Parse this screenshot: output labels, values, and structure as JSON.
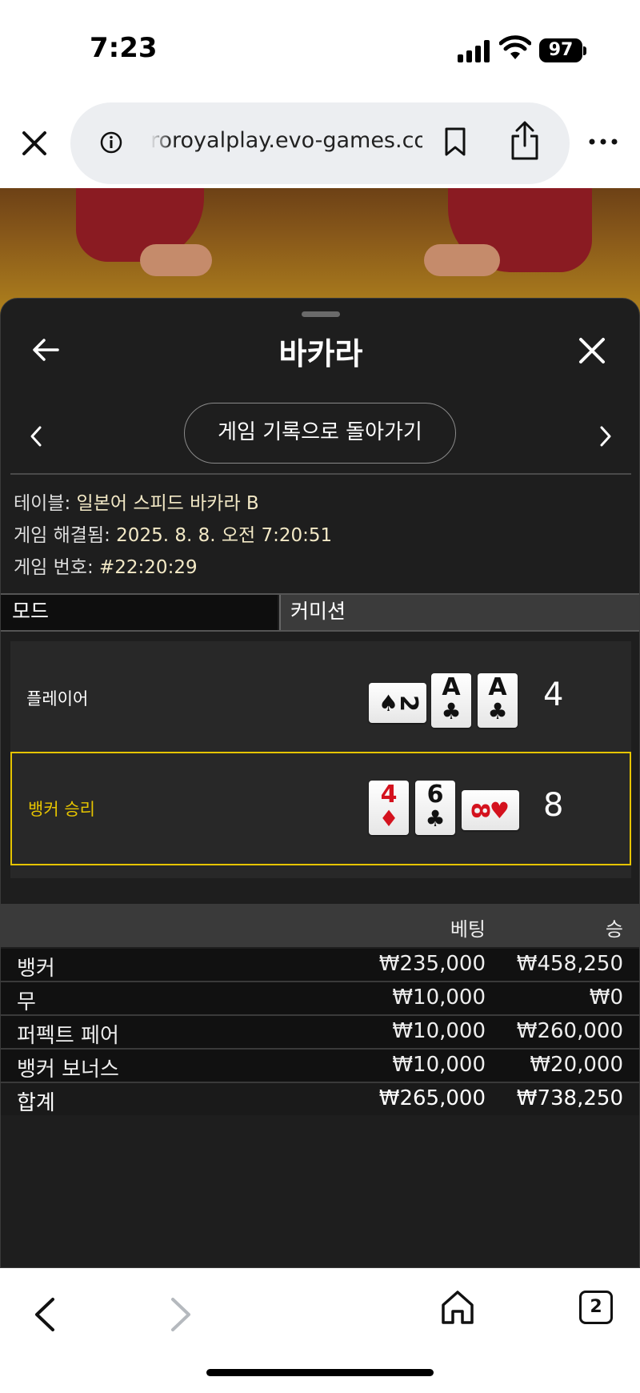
{
  "status_bar": {
    "time": "7:23",
    "battery": "97"
  },
  "browser": {
    "url": "roroyalplay.evo-games.com",
    "tab_count": "2"
  },
  "panel": {
    "title": "바카라",
    "return_button": "게임 기록으로 돌아가기",
    "info": [
      {
        "label": "테이블: ",
        "value": "일본어 스피드 바카라 B"
      },
      {
        "label": "게임 해결됨: ",
        "value": "2025. 8. 8. 오전 7:20:51"
      },
      {
        "label": "게임 번호: ",
        "value": "#22:20:29"
      }
    ],
    "tabs": {
      "mode": "모드",
      "commission": "커미션"
    }
  },
  "hands": {
    "player": {
      "label": "플레이어",
      "score": "4",
      "cards": [
        {
          "rank": "2",
          "suit": "♠",
          "color": "#111111",
          "sideways": true
        },
        {
          "rank": "A",
          "suit": "♣",
          "color": "#111111",
          "sideways": false
        },
        {
          "rank": "A",
          "suit": "♣",
          "color": "#111111",
          "sideways": false
        }
      ]
    },
    "banker": {
      "label": "뱅커 승리",
      "label_color": "#e6c400",
      "score": "8",
      "cards": [
        {
          "rank": "4",
          "suit": "♦",
          "color": "#d4121e",
          "sideways": false
        },
        {
          "rank": "6",
          "suit": "♣",
          "color": "#111111",
          "sideways": false
        },
        {
          "rank": "8",
          "suit": "♥",
          "color": "#d4121e",
          "sideways": true
        }
      ]
    }
  },
  "bets": {
    "headers": {
      "bet": "베팅",
      "win": "승"
    },
    "rows": [
      {
        "label": "뱅커",
        "bet": "₩235,000",
        "win": "₩458,250"
      },
      {
        "label": "무",
        "bet": "₩10,000",
        "win": "₩0"
      },
      {
        "label": "퍼펙트 페어",
        "bet": "₩10,000",
        "win": "₩260,000"
      },
      {
        "label": "뱅커 보너스",
        "bet": "₩10,000",
        "win": "₩20,000"
      }
    ],
    "total": {
      "label": "합계",
      "bet": "₩265,000",
      "win": "₩738,250"
    }
  },
  "icons": [
    "close-icon",
    "info-icon",
    "bookmark-icon",
    "share-icon",
    "more-icon",
    "back-arrow-icon",
    "chevron-left-icon",
    "chevron-right-icon",
    "home-icon",
    "tabs-icon"
  ]
}
